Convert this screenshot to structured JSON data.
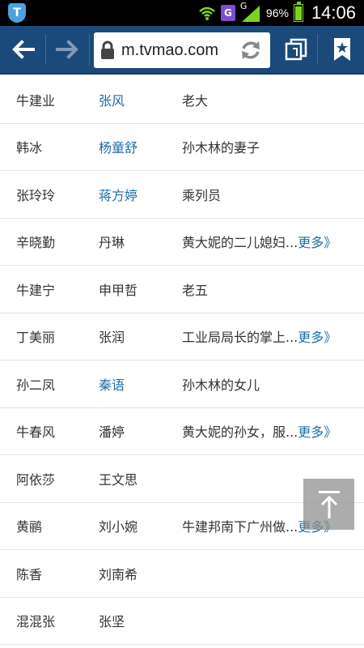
{
  "statusbar": {
    "battery": "96%",
    "time": "14:06",
    "network_letter": "G",
    "g_badge": "G"
  },
  "browser": {
    "url": "m.tvmao.com"
  },
  "rows": [
    {
      "role": "牛建业",
      "actor": "张风",
      "actor_link": true,
      "desc": "老大",
      "more": ""
    },
    {
      "role": "韩冰",
      "actor": "杨童舒",
      "actor_link": true,
      "desc": "孙木林的妻子",
      "more": ""
    },
    {
      "role": "张玲玲",
      "actor": "蒋方婷",
      "actor_link": true,
      "desc": "乘列员",
      "more": ""
    },
    {
      "role": "辛晓勤",
      "actor": "丹琳",
      "actor_link": false,
      "desc": "黄大妮的二儿媳妇...",
      "more": "更多》"
    },
    {
      "role": "牛建宁",
      "actor": "申甲哲",
      "actor_link": false,
      "desc": "老五",
      "more": ""
    },
    {
      "role": "丁美丽",
      "actor": "张润",
      "actor_link": false,
      "desc": "工业局局长的掌上...",
      "more": "更多》"
    },
    {
      "role": "孙二凤",
      "actor": "秦语",
      "actor_link": true,
      "desc": "孙木林的女儿",
      "more": ""
    },
    {
      "role": "牛春风",
      "actor": "潘婷",
      "actor_link": false,
      "desc": "黄大妮的孙女，服...",
      "more": "更多》"
    },
    {
      "role": "阿依莎",
      "actor": "王文思",
      "actor_link": false,
      "desc": "",
      "more": ""
    },
    {
      "role": "黄鹂",
      "actor": "刘小婉",
      "actor_link": false,
      "desc": "牛建邦南下广州做...",
      "more": "更多》"
    },
    {
      "role": "陈香",
      "actor": "刘南希",
      "actor_link": false,
      "desc": "",
      "more": ""
    },
    {
      "role": "混混张",
      "actor": "张坚",
      "actor_link": false,
      "desc": "",
      "more": ""
    }
  ],
  "colors": {
    "toolbar": "#1b4a7a",
    "link": "#1c6ea4",
    "divider": "#e3e3e3"
  }
}
